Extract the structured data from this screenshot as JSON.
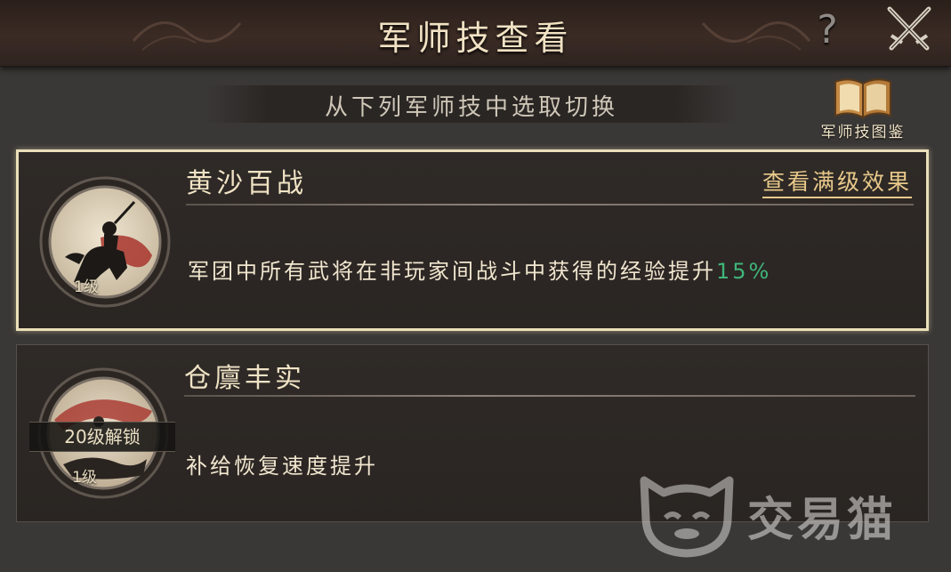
{
  "header": {
    "title": "军师技查看",
    "help_label": "?"
  },
  "subtitle": "从下列军师技中选取切换",
  "atlas_button": {
    "label": "军师技图鉴"
  },
  "skills": [
    {
      "name": "黄沙百战",
      "level": "1级",
      "max_effect_link": "查看满级效果",
      "description": "军团中所有武将在非玩家间战斗中获得的经验提升",
      "highlight": "15%",
      "selected": true
    },
    {
      "name": "仓廪丰实",
      "level": "1级",
      "lock_text": "20级解锁",
      "description": "补给恢复速度提升",
      "selected": false
    }
  ],
  "watermark": {
    "text": "交易猫"
  },
  "colors": {
    "title": "#f1e2c4",
    "highlight": "#3fb57a",
    "link": "#e8c98a",
    "selected_border": "#eadfb9"
  }
}
